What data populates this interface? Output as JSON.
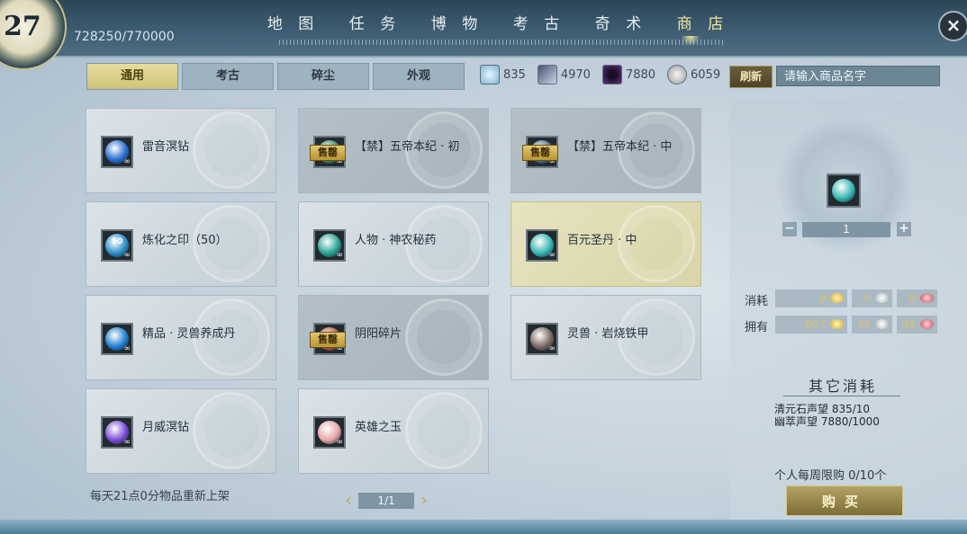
{
  "header": {
    "level": "27",
    "exp": "728250/770000",
    "tabs": [
      {
        "label": "地 图",
        "active": false
      },
      {
        "label": "任 务",
        "active": false
      },
      {
        "label": "博 物",
        "active": false
      },
      {
        "label": "考 古",
        "active": false
      },
      {
        "label": "奇 术",
        "active": false
      },
      {
        "label": "商 店",
        "active": true
      }
    ],
    "close_label": "×"
  },
  "subtabs": [
    {
      "label": "通用",
      "active": true
    },
    {
      "label": "考古",
      "active": false
    },
    {
      "label": "碎尘",
      "active": false
    },
    {
      "label": "外观",
      "active": false
    }
  ],
  "currencies": [
    {
      "icon": "blue-crystal-icon",
      "value": "835",
      "color": "#7fb6d6"
    },
    {
      "icon": "feather-icon",
      "value": "4970",
      "color": "#c8d4e8"
    },
    {
      "icon": "purple-orb-icon",
      "value": "7880",
      "color": "#5c2f87"
    },
    {
      "icon": "silver-coin-icon",
      "value": "6059",
      "color": "#bfbfbf"
    }
  ],
  "refresh_label": "刷新",
  "search": {
    "placeholder": "请输入商品名字"
  },
  "items": [
    {
      "name": "雷音溟钻",
      "sold": false,
      "selected": false,
      "icon_color": "#2a6fd1",
      "icon_text": ""
    },
    {
      "name": "【禁】五帝本纪 · 初",
      "sold": true,
      "selected": false,
      "icon_color": "#3a8a6a",
      "icon_text": ""
    },
    {
      "name": "【禁】五帝本纪 · 中",
      "sold": true,
      "selected": false,
      "icon_color": "#4f6f8c",
      "icon_text": ""
    },
    {
      "name": "炼化之印（50）",
      "sold": false,
      "selected": false,
      "icon_color": "#2a8fc9",
      "icon_text": "50"
    },
    {
      "name": "人物 · 神农秘药",
      "sold": false,
      "selected": false,
      "icon_color": "#2aa394",
      "icon_text": ""
    },
    {
      "name": "百元圣丹 · 中",
      "sold": false,
      "selected": true,
      "icon_color": "#36b6b0",
      "icon_text": ""
    },
    {
      "name": "精品 · 灵兽养成丹",
      "sold": false,
      "selected": false,
      "icon_color": "#1f7fd0",
      "icon_text": ""
    },
    {
      "name": "阴阳碎片",
      "sold": true,
      "selected": false,
      "icon_color": "#b35a44",
      "icon_text": ""
    },
    {
      "name": "灵兽 · 岩烧铁甲",
      "sold": false,
      "selected": false,
      "icon_color": "#7c6a60",
      "icon_text": ""
    },
    {
      "name": "月威溟钻",
      "sold": false,
      "selected": false,
      "icon_color": "#7c4bd6",
      "icon_text": ""
    },
    {
      "name": "英雄之玉",
      "sold": false,
      "selected": false,
      "icon_color": "#e5a5a5",
      "icon_text": ""
    }
  ],
  "sold_tag": "售罄",
  "infinity_mark": "∞",
  "restock_text": "每天21点0分物品重新上架",
  "pager": {
    "text": "1/1",
    "prev": "‹",
    "next": "›"
  },
  "detail": {
    "quantity": "1",
    "minus": "−",
    "plus": "+",
    "cost_label": "消耗",
    "own_label": "拥有",
    "cost": [
      "0",
      "0",
      "0"
    ],
    "own": [
      "607",
      "45",
      "49"
    ],
    "other_title": "其它消耗",
    "other": [
      "清元石声望 835/10",
      "幽萃声望 7880/1000"
    ],
    "limit": "个人每周限购 0/10个",
    "buy_label": "购买"
  }
}
